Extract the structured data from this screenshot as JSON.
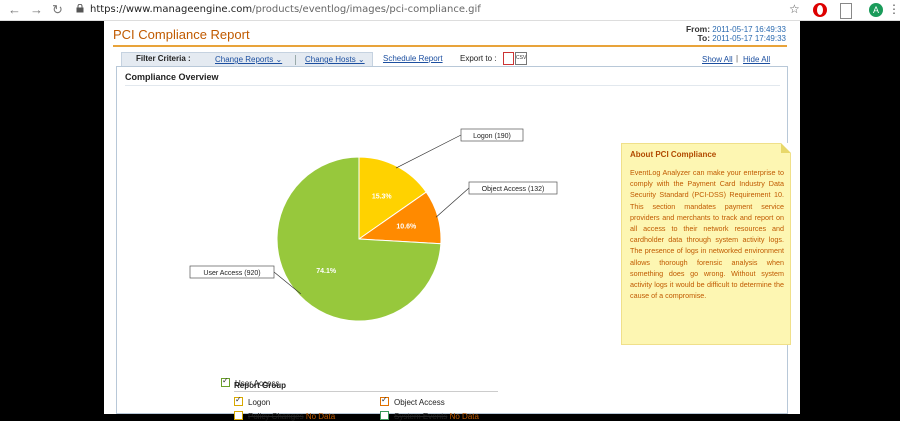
{
  "browser": {
    "url_host": "https://www.manageengine.com",
    "url_path": "/products/eventlog/images/pci-compliance.gif",
    "avatar_letter": "A"
  },
  "page": {
    "title": "PCI Compliance Report",
    "from_label": "From:",
    "from_value": "2011-05-17 16:49:33",
    "to_label": "To:",
    "to_value": "2011-05-17 17:49:33"
  },
  "toolbar": {
    "filter_label": "Filter Criteria :",
    "change_reports": "Change Reports ⌄",
    "change_hosts": "Change Hosts ⌄",
    "schedule_report": "Schedule Report",
    "export_label": "Export to :",
    "show_all": "Show All",
    "hide_all": "Hide All",
    "separator": "|",
    "csv": "CSV"
  },
  "overview": {
    "title": "Compliance Overview"
  },
  "about": {
    "title": "About PCI Compliance",
    "body": "EventLog Analyzer can make your enterprise to comply with the Payment Card Industry Data Security Standard (PCI-DSS) Requirement 10. This section mandates payment service providers and merchants to track and report on all access to their network resources and cardholder data through system activity logs. The presence of logs in networked environment allows thorough forensic analysis when something does go wrong. Without system activity logs it would be difficult to determine the cause of a compromise."
  },
  "legend": {
    "title": "Report Group",
    "items": [
      {
        "label": "Logon",
        "checked": true,
        "nodata": ""
      },
      {
        "label": "Object Access",
        "checked": true,
        "nodata": ""
      },
      {
        "label": "Policy Changes",
        "checked": false,
        "nodata": "No Data"
      },
      {
        "label": "System Events",
        "checked": false,
        "nodata": "No Data"
      },
      {
        "label": "User Access",
        "checked": true,
        "nodata": ""
      }
    ]
  },
  "chart_data": {
    "type": "pie",
    "series": [
      {
        "name": "Logon (190)",
        "value": 190,
        "percent_label": "15.3%",
        "color": "#ffd200"
      },
      {
        "name": "Object Access (132)",
        "value": 132,
        "percent_label": "10.6%",
        "color": "#ff8a00"
      },
      {
        "name": "User Access (920)",
        "value": 920,
        "percent_label": "74.1%",
        "color": "#97c83c"
      }
    ],
    "legend": "bottom"
  },
  "colors": {
    "accent": "#c05a00",
    "link": "#1c4fa0",
    "note_bg": "#fdf6b2"
  }
}
